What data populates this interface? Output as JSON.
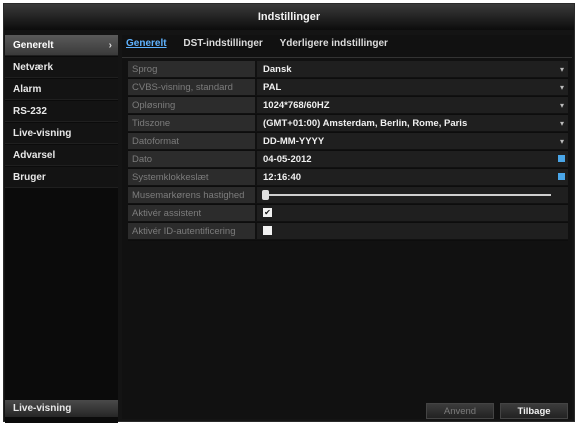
{
  "window": {
    "title": "Indstillinger"
  },
  "sidebar": {
    "items": [
      {
        "label": "Generelt",
        "active": true,
        "arrow": "›"
      },
      {
        "label": "Netværk"
      },
      {
        "label": "Alarm"
      },
      {
        "label": "RS-232"
      },
      {
        "label": "Live-visning"
      },
      {
        "label": "Advarsel"
      },
      {
        "label": "Bruger"
      }
    ],
    "bottom_label": "Live-visning"
  },
  "tabs": [
    {
      "label": "Generelt",
      "active": true
    },
    {
      "label": "DST-indstillinger"
    },
    {
      "label": "Yderligere indstillinger"
    }
  ],
  "form": {
    "rows": [
      {
        "label": "Sprog",
        "value": "Dansk",
        "dropdown": true
      },
      {
        "label": "CVBS-visning, standard",
        "value": "PAL",
        "dropdown": true
      },
      {
        "label": "Opløsning",
        "value": "1024*768/60HZ",
        "dropdown": true
      },
      {
        "label": "Tidszone",
        "value": "(GMT+01:00) Amsterdam, Berlin, Rome, Paris",
        "dropdown": true
      },
      {
        "label": "Datoformat",
        "value": "DD-MM-YYYY",
        "dropdown": true
      },
      {
        "label": "Dato",
        "value": "04-05-2012",
        "calendar": true
      },
      {
        "label": "Systemklokkeslæt",
        "value": "12:16:40",
        "calendar": true
      },
      {
        "label": "Musemarkørens hastighed",
        "slider_level": 0.0
      },
      {
        "label": "Aktivér assistent",
        "checked": true,
        "check_glyph": "✔"
      },
      {
        "label": "Aktivér ID-autentificering",
        "checked": false
      }
    ],
    "dropdown_glyph": "▾"
  },
  "buttons": {
    "apply": "Anvend",
    "back": "Tilbage"
  },
  "colors": {
    "accent": "#5fb3ff",
    "calendar_icon": "#4aa6e8"
  }
}
